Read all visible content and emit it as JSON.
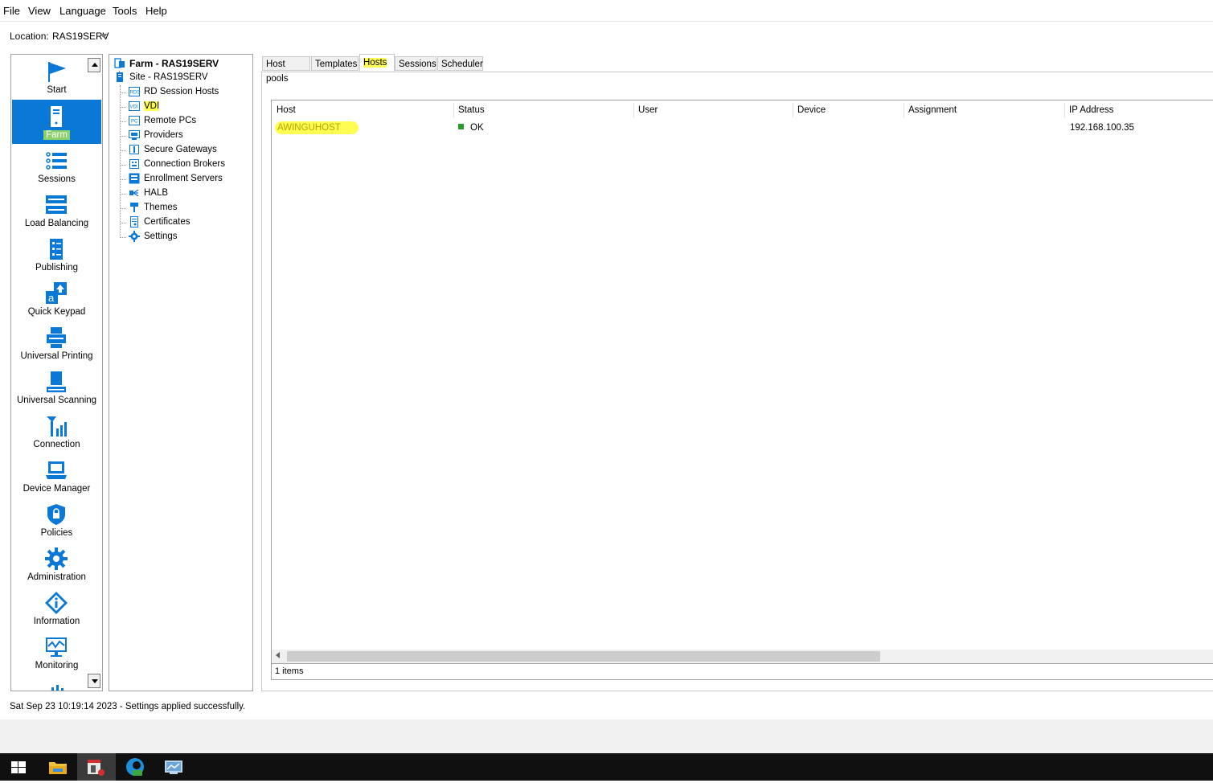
{
  "menu": [
    "File",
    "View",
    "Language",
    "Tools",
    "Help"
  ],
  "location": {
    "label": "Location:",
    "value": "RAS19SERV"
  },
  "nav": {
    "items": [
      {
        "label": "Start",
        "icon": "flag-icon"
      },
      {
        "label": "Farm",
        "icon": "server-icon",
        "selected": true
      },
      {
        "label": "Sessions",
        "icon": "list-icon"
      },
      {
        "label": "Load Balancing",
        "icon": "load-balancing-icon"
      },
      {
        "label": "Publishing",
        "icon": "publishing-checklist-icon"
      },
      {
        "label": "Quick Keypad",
        "icon": "quick-keypad-icon"
      },
      {
        "label": "Universal Printing",
        "icon": "printer-icon"
      },
      {
        "label": "Universal Scanning",
        "icon": "scanner-icon"
      },
      {
        "label": "Connection",
        "icon": "antenna-signal-icon"
      },
      {
        "label": "Device Manager",
        "icon": "laptop-icon"
      },
      {
        "label": "Policies",
        "icon": "shield-lock-icon"
      },
      {
        "label": "Administration",
        "icon": "gear-icon"
      },
      {
        "label": "Information",
        "icon": "info-diamond-icon"
      },
      {
        "label": "Monitoring",
        "icon": "monitor-chart-icon"
      }
    ]
  },
  "tree": {
    "farm": "Farm - RAS19SERV",
    "site": "Site - RAS19SERV",
    "items": [
      "RD Session Hosts",
      "VDI",
      "Remote PCs",
      "Providers",
      "Secure Gateways",
      "Connection Brokers",
      "Enrollment Servers",
      "HALB",
      "Themes",
      "Certificates",
      "Settings"
    ],
    "highlighted": "VDI"
  },
  "tabs": [
    {
      "label": "Host pools"
    },
    {
      "label": "Templates"
    },
    {
      "label": "Hosts",
      "active": true
    },
    {
      "label": "Sessions"
    },
    {
      "label": "Scheduler"
    }
  ],
  "grid": {
    "columns": [
      "Host",
      "Status",
      "User",
      "Device",
      "Assignment",
      "IP Address"
    ],
    "rows": [
      {
        "host": "AWINGUHOST",
        "status": "OK",
        "user": "",
        "device": "",
        "assignment": "",
        "ip": "192.168.100.35"
      }
    ],
    "footer": "1 items"
  },
  "status_message": "Sat Sep 23 10:19:14 2023 - Settings applied successfully.",
  "colors": {
    "accent": "#0a78d7",
    "highlight": "#fffd54",
    "status_ok": "#2a9b2a"
  },
  "taskbar": [
    "windows-start-icon",
    "file-explorer-icon",
    "ras-console-icon",
    "edge-dev-icon",
    "control-panel-icon"
  ]
}
